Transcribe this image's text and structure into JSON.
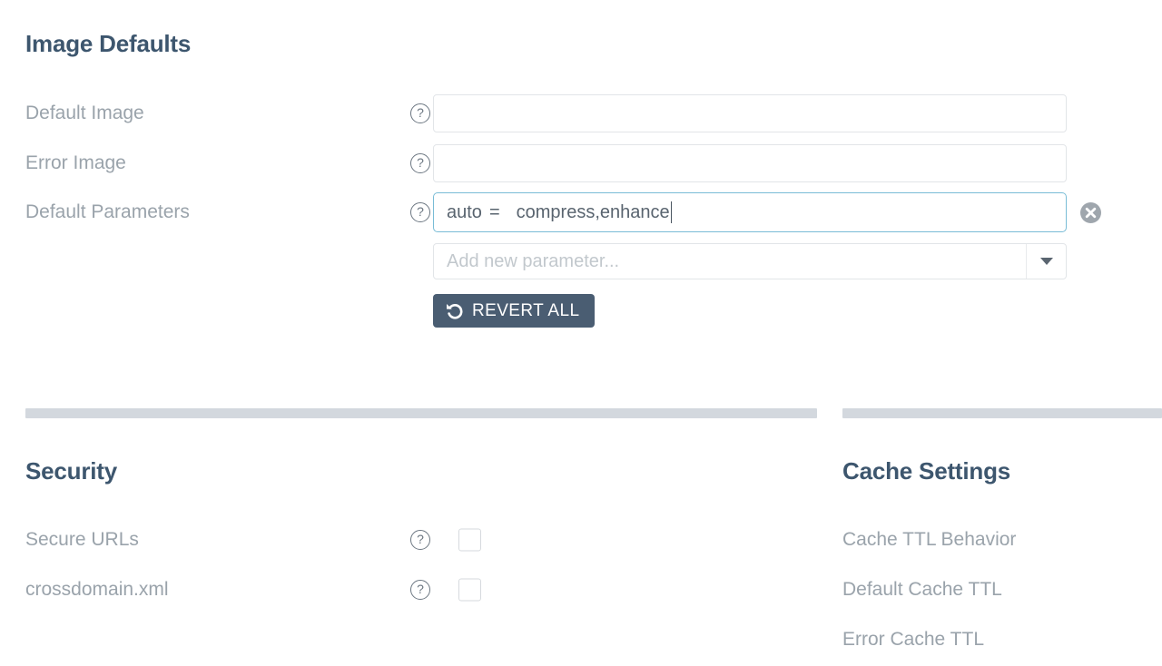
{
  "sections": {
    "image_defaults": {
      "title": "Image Defaults",
      "rows": [
        {
          "label": "Default Image",
          "help": "help-icon",
          "value": "",
          "placeholder": ""
        },
        {
          "label": "Error Image",
          "help": "help-icon",
          "value": "",
          "placeholder": ""
        },
        {
          "label": "Default Parameters",
          "help": "help-icon"
        }
      ],
      "parameter": {
        "key": "auto",
        "equals": "=",
        "value": "compress,enhance",
        "clear_icon": "circle-x-icon"
      },
      "add_parameter": {
        "placeholder": "Add new parameter...",
        "arrow_icon": "chevron-down-icon"
      },
      "revert_button": {
        "label": "REVERT ALL",
        "icon": "undo-arrow-icon"
      }
    },
    "security": {
      "title": "Security",
      "rows": [
        {
          "label": "Secure URLs",
          "help": "help-icon",
          "checked": false
        },
        {
          "label": "crossdomain.xml",
          "help": "help-icon",
          "checked": false
        }
      ]
    },
    "cache_settings": {
      "title": "Cache Settings",
      "rows": [
        {
          "label": "Cache TTL Behavior"
        },
        {
          "label": "Default Cache TTL"
        },
        {
          "label": "Error Cache TTL"
        }
      ]
    }
  },
  "colors": {
    "heading": "#3d566e",
    "label": "#9aa3ab",
    "focus_border": "#79bcd6",
    "button_bg": "#4a5d72",
    "divider": "#d3d8de"
  }
}
